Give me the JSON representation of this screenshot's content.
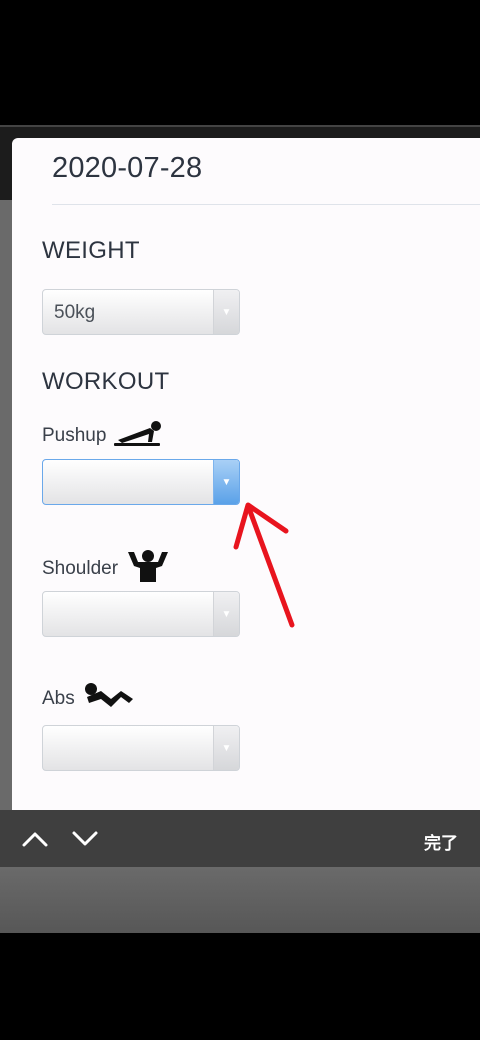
{
  "date": "2020-07-28",
  "weight": {
    "title": "WEIGHT",
    "value": "50kg"
  },
  "workout": {
    "title": "WORKOUT",
    "items": [
      {
        "label": "Pushup",
        "icon": "pushup-icon",
        "value": ""
      },
      {
        "label": "Shoulder",
        "icon": "shoulder-exercise-icon",
        "value": ""
      },
      {
        "label": "Abs",
        "icon": "situp-icon",
        "value": ""
      }
    ]
  },
  "toolbar": {
    "done_label": "完了",
    "prev_icon": "chevron-up-icon",
    "next_icon": "chevron-down-icon"
  },
  "colors": {
    "active_border": "#6aa8ea",
    "annotation_arrow": "#e8141e",
    "text": "#2d3440"
  }
}
